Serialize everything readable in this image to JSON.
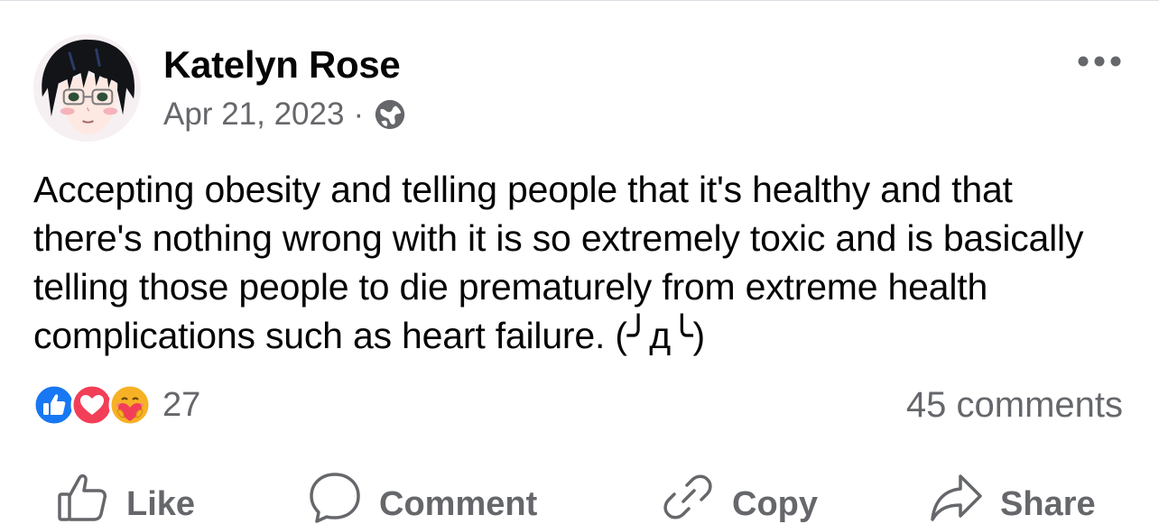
{
  "post": {
    "author": "Katelyn Rose",
    "date": "Apr 21, 2023",
    "separator": "·",
    "audience_icon": "globe-icon",
    "more_icon": "more-options-icon",
    "text": "Accepting obesity and telling people that it's healthy and that there's nothing wrong with it is so extremely toxic and is basically telling those people to die prematurely from extreme health complications such as heart failure. (╯д╰)"
  },
  "reactions": {
    "icons": [
      "like-reaction-icon",
      "love-reaction-icon",
      "care-reaction-icon"
    ],
    "count": "27"
  },
  "comments": {
    "label": "45 comments"
  },
  "actions": [
    {
      "label": "Like",
      "icon": "thumbs-up-icon"
    },
    {
      "label": "Comment",
      "icon": "comment-bubble-icon"
    },
    {
      "label": "Copy",
      "icon": "link-icon"
    },
    {
      "label": "Share",
      "icon": "share-arrow-icon"
    }
  ],
  "colors": {
    "text": "#050505",
    "secondary": "#65676b",
    "like_blue": "#1877f2",
    "love_red": "#f33e58",
    "care_yellow": "#f7b125"
  }
}
